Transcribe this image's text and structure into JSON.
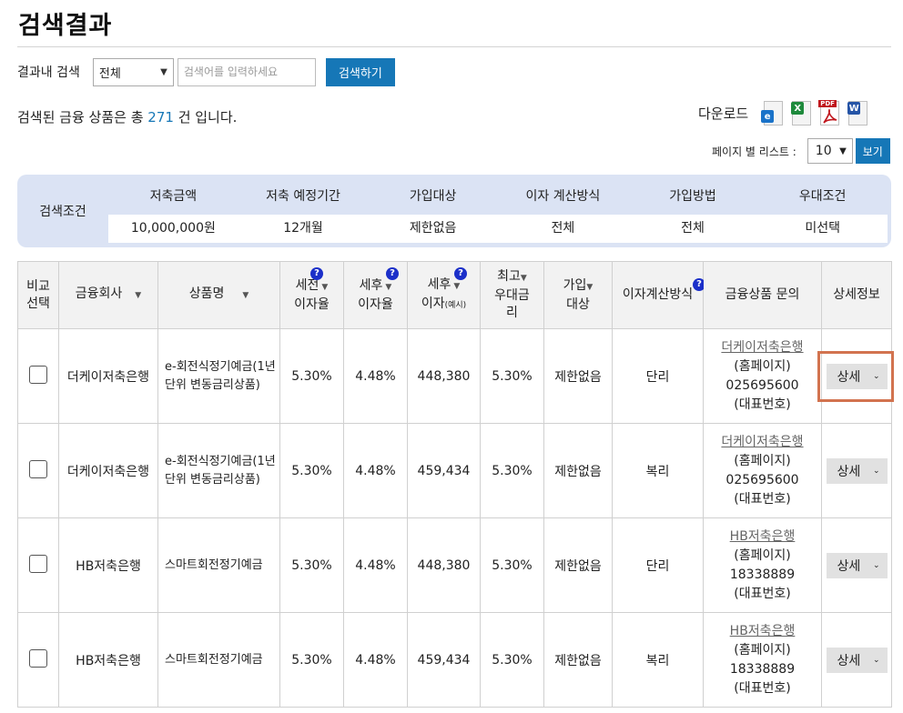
{
  "page": {
    "title": "검색결과"
  },
  "search": {
    "label": "결과내 검색",
    "scope_selected": "전체",
    "input_value": "",
    "placeholder": "검색어를 입력하세요",
    "button": "검색하기"
  },
  "result": {
    "prefix": "검색된 금융 상품은 총 ",
    "count": "271",
    "suffix": " 건 입니다."
  },
  "download": {
    "label": "다운로드",
    "icons": [
      "ie-icon",
      "excel-icon",
      "pdf-icon",
      "word-icon"
    ]
  },
  "pagination": {
    "label": "페이지 별 리스트 :",
    "selected": "10",
    "button": "보기"
  },
  "conditions": {
    "title": "검색조건",
    "headers": [
      "저축금액",
      "저축 예정기간",
      "가입대상",
      "이자 계산방식",
      "가입방법",
      "우대조건"
    ],
    "values": [
      "10,000,000원",
      "12개월",
      "제한없음",
      "전체",
      "전체",
      "미선택"
    ]
  },
  "table": {
    "headers": {
      "compare_1": "비교",
      "compare_2": "선택",
      "company": "금융회사",
      "product": "상품명",
      "pretax_1": "세전",
      "pretax_2": "이자율",
      "aftertax_1": "세후",
      "aftertax_2": "이자율",
      "aftertax_interest_1": "세후",
      "aftertax_interest_2": "이자",
      "aftertax_interest_3": "(예시)",
      "max_rate_1": "최고",
      "max_rate_2": "우대금",
      "max_rate_3": "리",
      "join_target_1": "가입",
      "join_target_2": "대상",
      "calc_method": "이자계산방식",
      "inquiry": "금융상품 문의",
      "detail": "상세정보"
    },
    "help_mark": "?",
    "rows": [
      {
        "company": "더케이저축은행",
        "product": "e-회전식정기예금(1년 단위 변동금리상품)",
        "pretax": "5.30%",
        "aftertax": "4.48%",
        "interest": "448,380",
        "max_rate": "5.30%",
        "target": "제한없음",
        "method": "단리",
        "bank_link": "더케이저축은행",
        "home": "(홈페이지)",
        "phone": "025695600",
        "rep": "(대표번호)",
        "detail": "상세"
      },
      {
        "company": "더케이저축은행",
        "product": "e-회전식정기예금(1년 단위 변동금리상품)",
        "pretax": "5.30%",
        "aftertax": "4.48%",
        "interest": "459,434",
        "max_rate": "5.30%",
        "target": "제한없음",
        "method": "복리",
        "bank_link": "더케이저축은행",
        "home": "(홈페이지)",
        "phone": "025695600",
        "rep": "(대표번호)",
        "detail": "상세"
      },
      {
        "company": "HB저축은행",
        "product": "스마트회전정기예금",
        "pretax": "5.30%",
        "aftertax": "4.48%",
        "interest": "448,380",
        "max_rate": "5.30%",
        "target": "제한없음",
        "method": "단리",
        "bank_link": "HB저축은행",
        "home": "(홈페이지)",
        "phone": "18338889",
        "rep": "(대표번호)",
        "detail": "상세"
      },
      {
        "company": "HB저축은행",
        "product": "스마트회전정기예금",
        "pretax": "5.30%",
        "aftertax": "4.48%",
        "interest": "459,434",
        "max_rate": "5.30%",
        "target": "제한없음",
        "method": "복리",
        "bank_link": "HB저축은행",
        "home": "(홈페이지)",
        "phone": "18338889",
        "rep": "(대표번호)",
        "detail": "상세"
      }
    ]
  },
  "colors": {
    "accent": "#1677b7",
    "help": "#1b2fc9",
    "condition_bg": "#dbe3f4",
    "highlight": "#d2734f"
  }
}
